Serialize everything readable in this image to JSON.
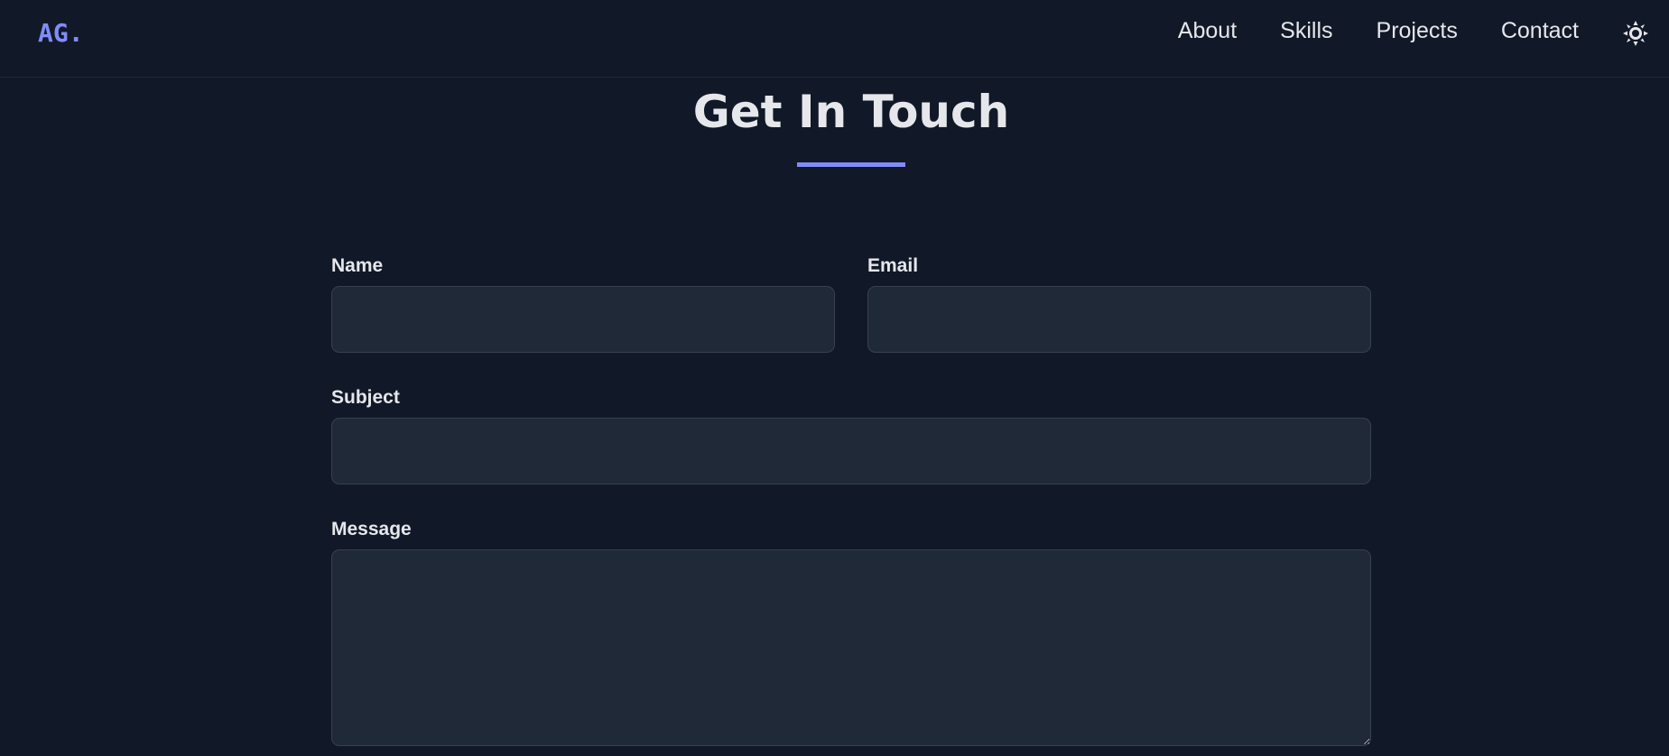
{
  "navbar": {
    "logo": "AG.",
    "links": [
      "About",
      "Skills",
      "Projects",
      "Contact"
    ],
    "theme_icon": "sun-icon"
  },
  "section": {
    "title": "Get In Touch",
    "accent_color": "#818cf8"
  },
  "form": {
    "name_label": "Name",
    "name_value": "",
    "email_label": "Email",
    "email_value": "",
    "subject_label": "Subject",
    "subject_value": "",
    "message_label": "Message",
    "message_value": ""
  },
  "colors": {
    "background": "#111827",
    "input_bg": "#1f2937",
    "accent": "#818cf8"
  }
}
